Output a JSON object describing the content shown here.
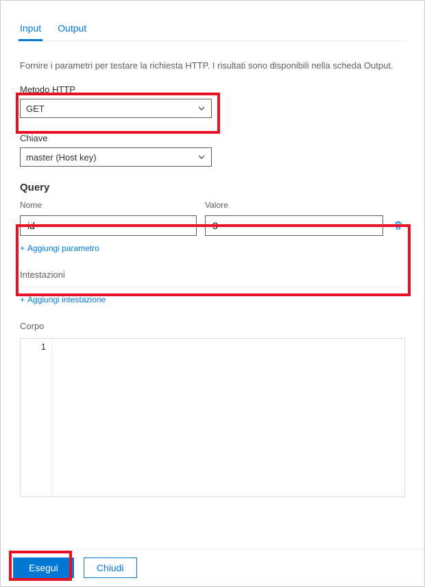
{
  "tabs": {
    "input": "Input",
    "output": "Output"
  },
  "description": "Fornire i parametri per testare la richiesta HTTP. I risultati sono disponibili nella scheda Output.",
  "method": {
    "label": "Metodo HTTP",
    "value": "GET"
  },
  "key": {
    "label": "Chiave",
    "value": "master (Host key)"
  },
  "query": {
    "title": "Query",
    "name_header": "Nome",
    "value_header": "Valore",
    "rows": [
      {
        "name": "id",
        "value": "3"
      }
    ],
    "add_label": "Aggiungi parametro"
  },
  "headers_section": {
    "label": "Intestazioni",
    "add_label": "Aggiungi intestazione"
  },
  "body_section": {
    "label": "Corpo",
    "line_number": "1"
  },
  "footer": {
    "run": "Esegui",
    "close": "Chiudi"
  },
  "plus_glyph": "+"
}
